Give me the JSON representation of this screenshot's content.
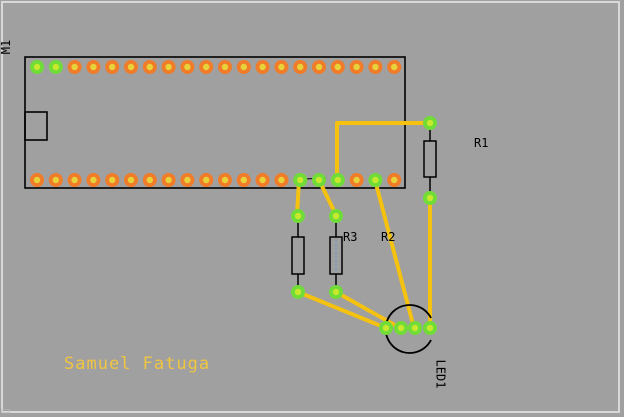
{
  "board": {
    "background": "#a0a0a0",
    "border_color": "#d8d8d8",
    "trace_color": "#f5c20f",
    "pad_color_connected": "#6fdc38",
    "pad_color_unconnected": "#f07c2a",
    "author_text_color": "#f0c540"
  },
  "labels": {
    "module": "M1",
    "r1": "R1",
    "r2": "R2",
    "r3": "R3",
    "led": "LED1",
    "author": "Samuel Fatuga"
  },
  "components": [
    {
      "ref": "M1",
      "type": "microcontroller-module",
      "pins_per_row": 20,
      "rows": 2
    },
    {
      "ref": "R1",
      "type": "resistor"
    },
    {
      "ref": "R2",
      "type": "resistor"
    },
    {
      "ref": "R3",
      "type": "resistor"
    },
    {
      "ref": "LED1",
      "type": "led-4-pin"
    }
  ]
}
